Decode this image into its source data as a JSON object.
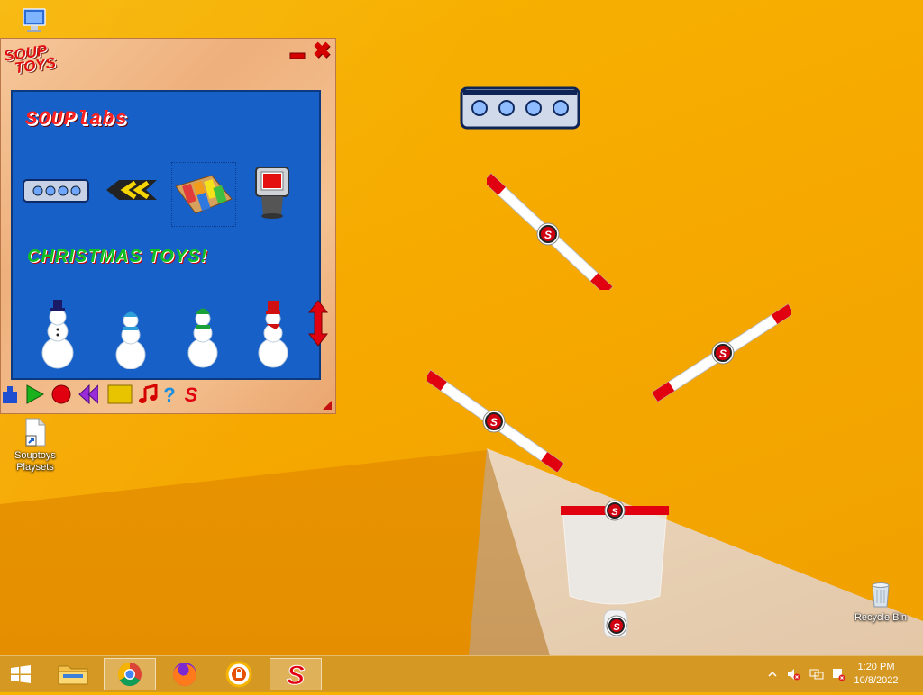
{
  "desktop": {
    "icons": [
      {
        "name": "computer-icon",
        "label": ""
      },
      {
        "name": "souptoys-playsets-shortcut",
        "label": "Souptoys Playsets"
      },
      {
        "name": "recycle-bin",
        "label": "Recycle Bin"
      }
    ]
  },
  "souptoys_window": {
    "logo_line1": "SOUP",
    "logo_line2": "TOYS",
    "category1_title": "SOUPlabs",
    "category1_items": [
      "lightbar-icon",
      "chevron-arrow-icon",
      "xylophone-icon",
      "retro-tv-icon"
    ],
    "category2_title": "CHRISTMAS TOYS!",
    "category2_items": [
      "snowman-blue-hat-icon",
      "snowman-blue-beanie-icon",
      "snowman-green-hat-icon",
      "snowman-red-hat-icon"
    ],
    "toolbar": [
      "robot-tool-icon",
      "play-icon",
      "record-icon",
      "rewind-icon",
      "stop-icon",
      "music-icon",
      "help-icon",
      "souptoys-icon"
    ]
  },
  "taskbar": {
    "apps": [
      "start-icon",
      "file-explorer-icon",
      "chrome-icon",
      "firefox-icon",
      "vpn-icon",
      "souptoys-taskbar-icon"
    ],
    "active_app": "souptoys-taskbar-icon",
    "time": "1:20 PM",
    "date": "10/8/2022"
  },
  "colors": {
    "wallpaper": "#f6a900",
    "panel_blue": "#1660c8",
    "toy_red": "#e00010"
  }
}
